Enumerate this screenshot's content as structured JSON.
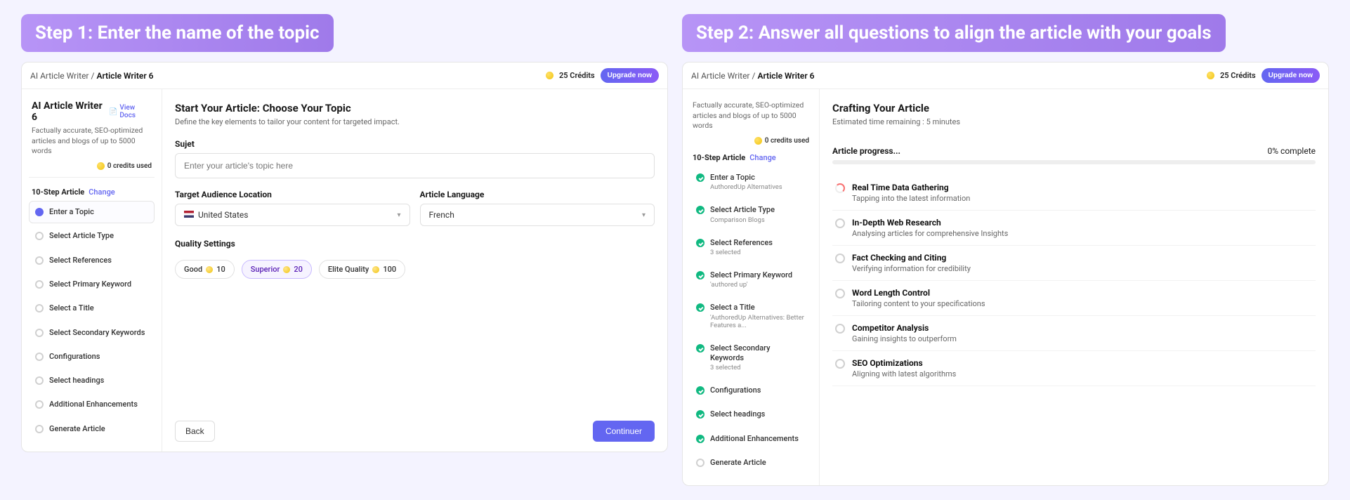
{
  "step1": {
    "banner": "Step 1: Enter the name of the topic",
    "breadcrumb_prefix": "AI Article Writer",
    "breadcrumb_current": "Article Writer 6",
    "credits": "25 Crédits",
    "upgrade": "Upgrade now",
    "app_title": "AI Article Writer 6",
    "view_docs": "View Docs",
    "app_sub": "Factually accurate, SEO-optimized articles and blogs of up to 5000 words",
    "sidebar_credits": "0 credits used",
    "step_header": "10-Step Article",
    "change_link": "Change",
    "steps": [
      {
        "label": "Enter a Topic",
        "state": "current"
      },
      {
        "label": "Select Article Type"
      },
      {
        "label": "Select References"
      },
      {
        "label": "Select Primary Keyword"
      },
      {
        "label": "Select a Title"
      },
      {
        "label": "Select Secondary Keywords"
      },
      {
        "label": "Configurations"
      },
      {
        "label": "Select headings"
      },
      {
        "label": "Additional Enhancements"
      },
      {
        "label": "Generate Article"
      }
    ],
    "main_title": "Start Your Article: Choose Your Topic",
    "main_desc": "Define the key elements to tailor your content for targeted impact.",
    "subject_label": "Sujet",
    "subject_placeholder": "Enter your article's topic here",
    "audience_label": "Target Audience Location",
    "audience_value": "United States",
    "language_label": "Article Language",
    "language_value": "French",
    "quality_label": "Quality Settings",
    "quality_options": [
      {
        "name": "Good",
        "cost": "10"
      },
      {
        "name": "Superior",
        "cost": "20",
        "selected": true
      },
      {
        "name": "Elite Quality",
        "cost": "100"
      }
    ],
    "back": "Back",
    "continue": "Continuer"
  },
  "step2": {
    "banner": "Step 2: Answer all questions to align the article with your goals",
    "breadcrumb_prefix": "AI Article Writer",
    "breadcrumb_current": "Article Writer 6",
    "credits": "25 Crédits",
    "upgrade": "Upgrade now",
    "app_sub": "Factually accurate, SEO-optimized articles and blogs of up to 5000 words",
    "sidebar_credits": "0 credits used",
    "step_header": "10-Step Article",
    "change_link": "Change",
    "steps": [
      {
        "label": "Enter a Topic",
        "sub": "AuthoredUp Alternatives",
        "state": "done"
      },
      {
        "label": "Select Article Type",
        "sub": "Comparison Blogs",
        "state": "done"
      },
      {
        "label": "Select References",
        "sub": "3 selected",
        "state": "done"
      },
      {
        "label": "Select Primary Keyword",
        "sub": "'authored up'",
        "state": "done"
      },
      {
        "label": "Select a Title",
        "sub": "'AuthoredUp Alternatives: Better Features a...",
        "state": "done"
      },
      {
        "label": "Select Secondary Keywords",
        "sub": "3 selected",
        "state": "done"
      },
      {
        "label": "Configurations",
        "state": "done"
      },
      {
        "label": "Select headings",
        "state": "done"
      },
      {
        "label": "Additional Enhancements",
        "state": "done"
      },
      {
        "label": "Generate Article"
      }
    ],
    "main_title": "Crafting Your Article",
    "eta": "Estimated time remaining : 5 minutes",
    "progress_label": "Article progress...",
    "progress_value": "0% complete",
    "tasks": [
      {
        "title": "Real Time Data Gathering",
        "sub": "Tapping into the latest information",
        "state": "spinning"
      },
      {
        "title": "In-Depth Web Research",
        "sub": "Analysing articles for comprehensive Insights"
      },
      {
        "title": "Fact Checking and Citing",
        "sub": "Verifying information for credibility"
      },
      {
        "title": "Word Length Control",
        "sub": "Tailoring content to your specifications"
      },
      {
        "title": "Competitor Analysis",
        "sub": "Gaining insights to outperform"
      },
      {
        "title": "SEO Optimizations",
        "sub": "Aligning with latest algorithms"
      }
    ]
  }
}
